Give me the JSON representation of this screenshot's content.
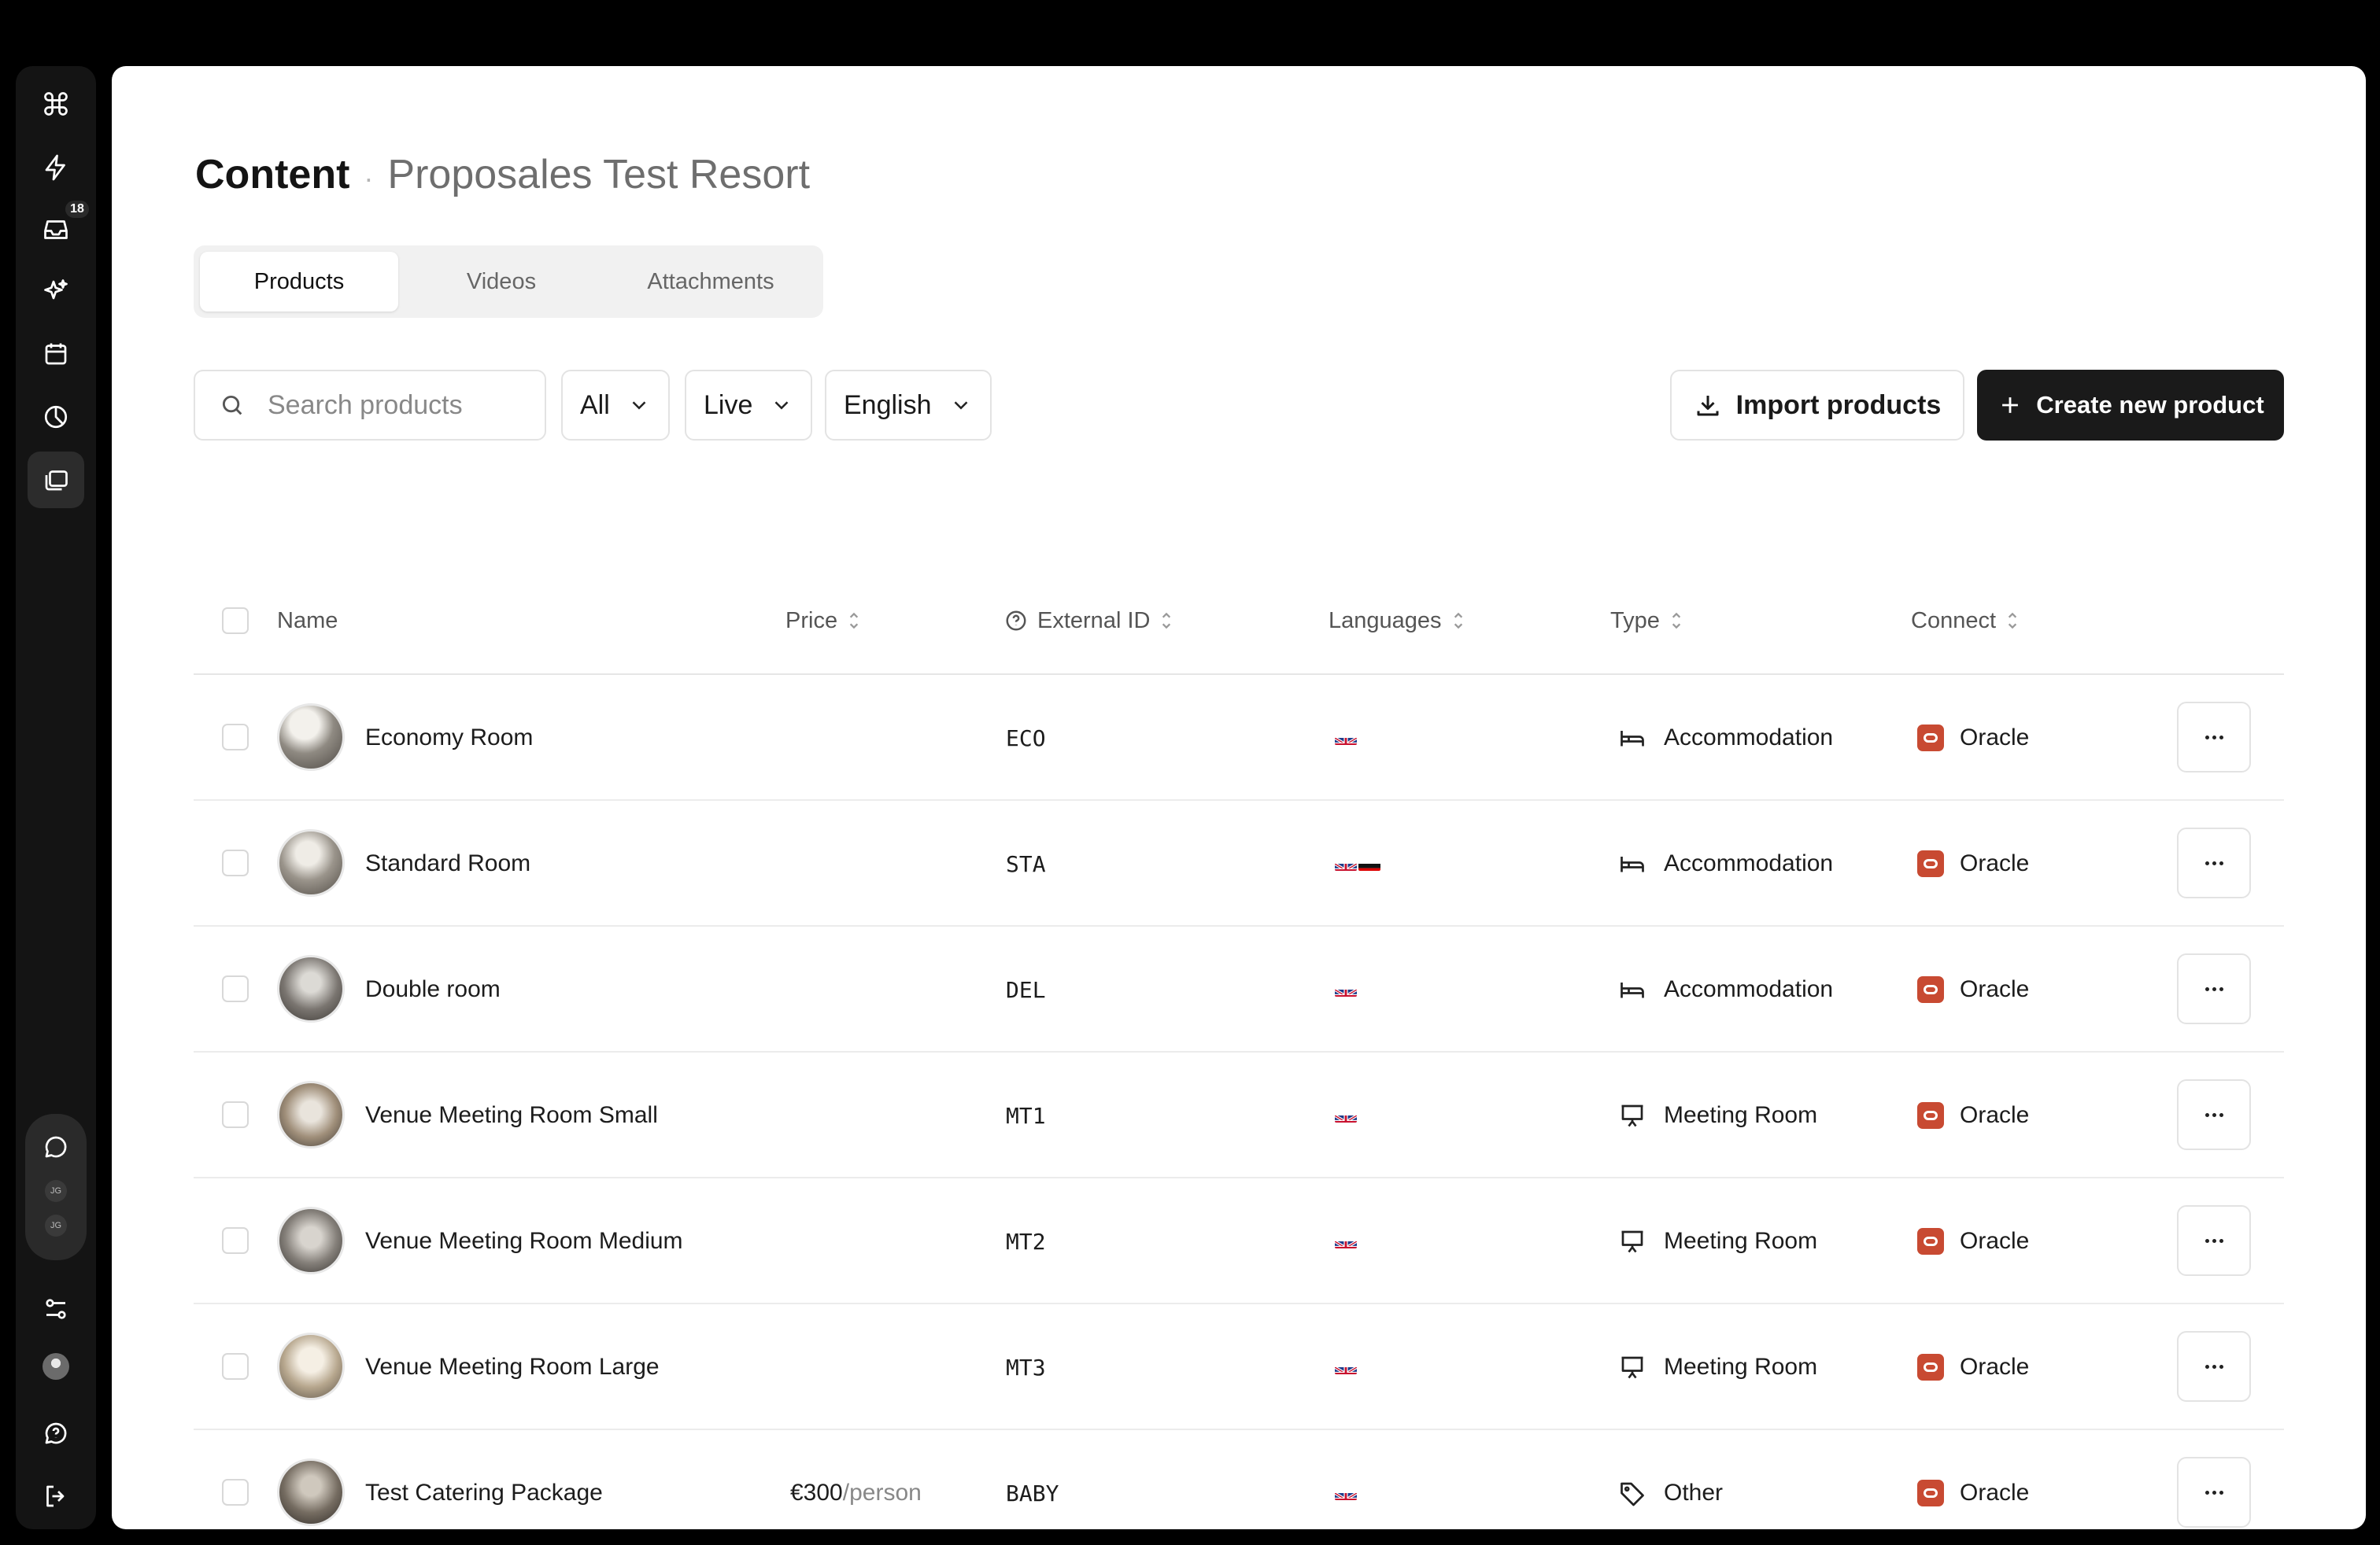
{
  "sidebar": {
    "inbox_badge": "18",
    "pill_avatars": [
      "JG",
      "JG"
    ]
  },
  "header": {
    "title": "Content",
    "separator": "·",
    "subtitle": "Proposales Test Resort"
  },
  "tabs": [
    {
      "label": "Products",
      "active": true
    },
    {
      "label": "Videos",
      "active": false
    },
    {
      "label": "Attachments",
      "active": false
    }
  ],
  "toolbar": {
    "search_placeholder": "Search products",
    "filter_status": "All",
    "filter_state": "Live",
    "filter_language": "English",
    "import_label": "Import products",
    "create_label": "Create new product"
  },
  "table": {
    "columns": [
      "Name",
      "Price",
      "External ID",
      "Languages",
      "Type",
      "Connect"
    ],
    "rows": [
      {
        "name": "Economy Room",
        "price": "",
        "price_unit": "",
        "external_id": "ECO",
        "languages": [
          "gb"
        ],
        "type": "Accommodation",
        "type_icon": "bed-icon",
        "connect": "Oracle"
      },
      {
        "name": "Standard Room",
        "price": "",
        "price_unit": "",
        "external_id": "STA",
        "languages": [
          "gb",
          "de"
        ],
        "type": "Accommodation",
        "type_icon": "bed-icon",
        "connect": "Oracle"
      },
      {
        "name": "Double room",
        "price": "",
        "price_unit": "",
        "external_id": "DEL",
        "languages": [
          "gb"
        ],
        "type": "Accommodation",
        "type_icon": "bed-icon",
        "connect": "Oracle"
      },
      {
        "name": "Venue Meeting Room Small",
        "price": "",
        "price_unit": "",
        "external_id": "MT1",
        "languages": [
          "gb"
        ],
        "type": "Meeting Room",
        "type_icon": "presentation-icon",
        "connect": "Oracle"
      },
      {
        "name": "Venue Meeting Room Medium",
        "price": "",
        "price_unit": "",
        "external_id": "MT2",
        "languages": [
          "gb"
        ],
        "type": "Meeting Room",
        "type_icon": "presentation-icon",
        "connect": "Oracle"
      },
      {
        "name": "Venue Meeting Room Large",
        "price": "",
        "price_unit": "",
        "external_id": "MT3",
        "languages": [
          "gb"
        ],
        "type": "Meeting Room",
        "type_icon": "presentation-icon",
        "connect": "Oracle"
      },
      {
        "name": "Test Catering Package",
        "price": "€300",
        "price_unit": "/person",
        "external_id": "BABY",
        "languages": [
          "gb"
        ],
        "type": "Other",
        "type_icon": "tag-icon",
        "connect": "Oracle"
      }
    ]
  },
  "colors": {
    "accent": "#1a1a1a",
    "oracle": "#c84a32",
    "fab": "#3a78f2"
  }
}
